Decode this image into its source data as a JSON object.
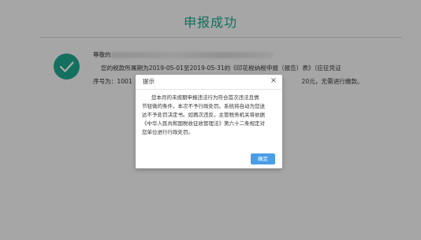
{
  "page": {
    "title": "申报成功"
  },
  "message": {
    "greeting": "尊敬的",
    "line1": "您的税款所属期为2019-05-01至2019-05-31的《印花税纳税申报（报告）表》（应征凭证",
    "line2_prefix": "序号为：1001",
    "line2_suffix": "20元，无需进行缴款。"
  },
  "dialog": {
    "title": "提示",
    "close_glyph": "×",
    "body_lines": [
      "您本月的未按期申报违法行为符合首次违法且情",
      "节轻微的条件，本次不予行政处罚。系统将自动为您送",
      "达不予处罚决定书。如再次违反，主管税务机关将依据",
      "《中华人民共和国税收征收管理法》第六十二条规定对",
      "您单位进行行政处罚。"
    ],
    "confirm_label": "确定"
  },
  "colors": {
    "accent": "#1aa38a",
    "button": "#4a9de6"
  }
}
